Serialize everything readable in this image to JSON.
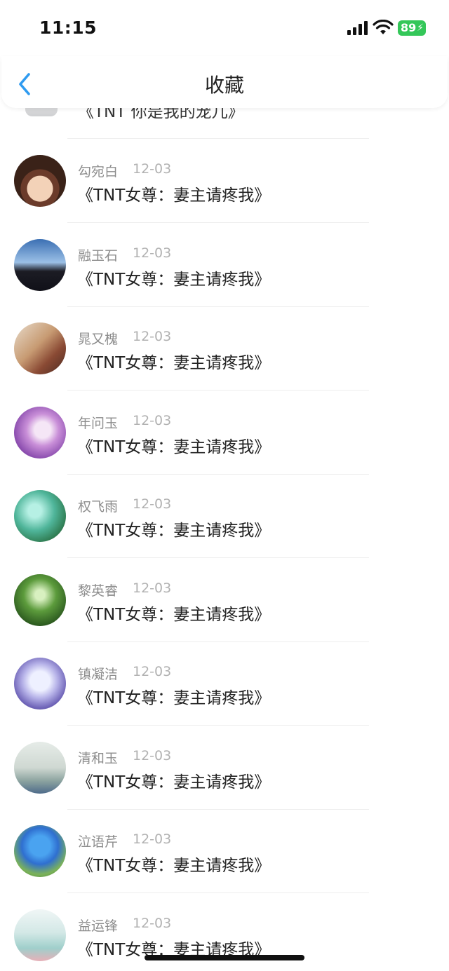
{
  "status": {
    "time": "11:15",
    "battery": "89"
  },
  "header": {
    "title": "收藏"
  },
  "partial_item": {
    "title": "《TNT 你是我的宠儿》"
  },
  "items": [
    {
      "name": "勾宛白",
      "date": "12-03",
      "title": "《TNT女尊：妻主请疼我》"
    },
    {
      "name": "融玉石",
      "date": "12-03",
      "title": "《TNT女尊：妻主请疼我》"
    },
    {
      "name": "晁又槐",
      "date": "12-03",
      "title": "《TNT女尊：妻主请疼我》"
    },
    {
      "name": "年问玉",
      "date": "12-03",
      "title": "《TNT女尊：妻主请疼我》"
    },
    {
      "name": "权飞雨",
      "date": "12-03",
      "title": "《TNT女尊：妻主请疼我》"
    },
    {
      "name": "黎英睿",
      "date": "12-03",
      "title": "《TNT女尊：妻主请疼我》"
    },
    {
      "name": "镇凝洁",
      "date": "12-03",
      "title": "《TNT女尊：妻主请疼我》"
    },
    {
      "name": "清和玉",
      "date": "12-03",
      "title": "《TNT女尊：妻主请疼我》"
    },
    {
      "name": "泣语芹",
      "date": "12-03",
      "title": "《TNT女尊：妻主请疼我》"
    },
    {
      "name": "益运锋",
      "date": "12-03",
      "title": "《TNT女尊：妻主请疼我》"
    }
  ],
  "colors": {
    "accent": "#2f9bf0",
    "battery": "#34c759"
  }
}
